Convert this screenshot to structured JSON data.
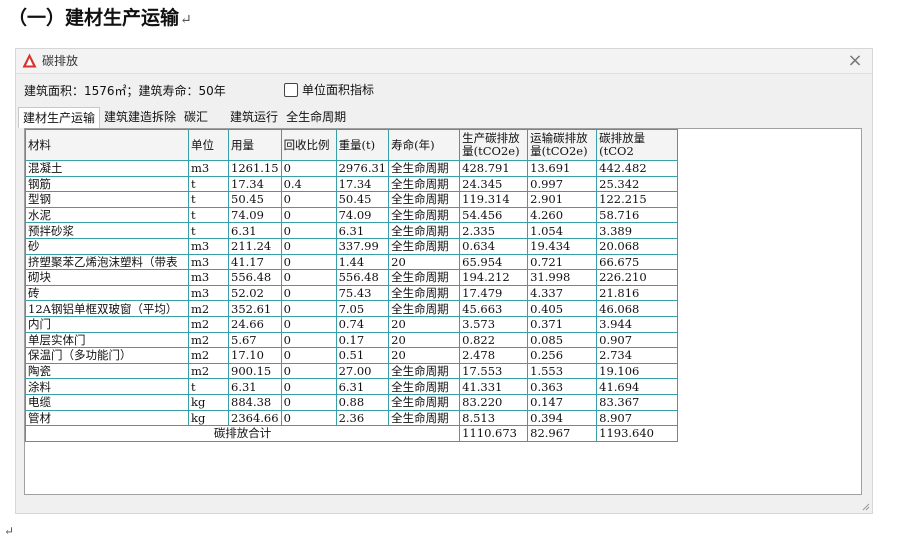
{
  "doc": {
    "heading": "（一）建材生产运输",
    "para_mark": "↵",
    "foot_mark": "↵"
  },
  "window": {
    "title": "碳排放",
    "close_glyph": "×",
    "info": "建筑面积：1576㎡；建筑寿命：50年",
    "checkbox_label": "单位面积指标",
    "tabs": [
      {
        "label": "建材生产运输",
        "active": true
      },
      {
        "label": "建筑建造拆除",
        "active": false
      },
      {
        "label": "碳汇",
        "active": false
      },
      {
        "label": "建筑运行",
        "active": false
      },
      {
        "label": "全生命周期",
        "active": false
      }
    ]
  },
  "table": {
    "columns": [
      "材料",
      "单位",
      "用量",
      "回收比例",
      "重量(t)",
      "寿命(年)",
      "生产碳排放量(tCO2e)",
      "运输碳排放量(tCO2e)",
      "碳排放量(tCO2"
    ],
    "rows": [
      [
        "混凝土",
        "m3",
        "1261.15",
        "0",
        "2976.31",
        "全生命周期",
        "428.791",
        "13.691",
        "442.482"
      ],
      [
        "钢筋",
        "t",
        "17.34",
        "0.4",
        "17.34",
        "全生命周期",
        "24.345",
        "0.997",
        "25.342"
      ],
      [
        "型钢",
        "t",
        "50.45",
        "0",
        "50.45",
        "全生命周期",
        "119.314",
        "2.901",
        "122.215"
      ],
      [
        "水泥",
        "t",
        "74.09",
        "0",
        "74.09",
        "全生命周期",
        "54.456",
        "4.260",
        "58.716"
      ],
      [
        "预拌砂浆",
        "t",
        "6.31",
        "0",
        "6.31",
        "全生命周期",
        "2.335",
        "1.054",
        "3.389"
      ],
      [
        "砂",
        "m3",
        "211.24",
        "0",
        "337.99",
        "全生命周期",
        "0.634",
        "19.434",
        "20.068"
      ],
      [
        "挤塑聚苯乙烯泡沫塑料（带表",
        "m3",
        "41.17",
        "0",
        "1.44",
        "20",
        "65.954",
        "0.721",
        "66.675"
      ],
      [
        "砌块",
        "m3",
        "556.48",
        "0",
        "556.48",
        "全生命周期",
        "194.212",
        "31.998",
        "226.210"
      ],
      [
        "砖",
        "m3",
        "52.02",
        "0",
        "75.43",
        "全生命周期",
        "17.479",
        "4.337",
        "21.816"
      ],
      [
        "12A钢铝单框双玻窗（平均）",
        "m2",
        "352.61",
        "0",
        "7.05",
        "全生命周期",
        "45.663",
        "0.405",
        "46.068"
      ],
      [
        "内门",
        "m2",
        "24.66",
        "0",
        "0.74",
        "20",
        "3.573",
        "0.371",
        "3.944"
      ],
      [
        "单层实体门",
        "m2",
        "5.67",
        "0",
        "0.17",
        "20",
        "0.822",
        "0.085",
        "0.907"
      ],
      [
        "保温门（多功能门）",
        "m2",
        "17.10",
        "0",
        "0.51",
        "20",
        "2.478",
        "0.256",
        "2.734"
      ],
      [
        "陶瓷",
        "m2",
        "900.15",
        "0",
        "27.00",
        "全生命周期",
        "17.553",
        "1.553",
        "19.106"
      ],
      [
        "涂料",
        "t",
        "6.31",
        "0",
        "6.31",
        "全生命周期",
        "41.331",
        "0.363",
        "41.694"
      ],
      [
        "电缆",
        "kg",
        "884.38",
        "0",
        "0.88",
        "全生命周期",
        "83.220",
        "0.147",
        "83.367"
      ],
      [
        "管材",
        "kg",
        "2364.66",
        "0",
        "2.36",
        "全生命周期",
        "8.513",
        "0.394",
        "8.907"
      ]
    ],
    "total": {
      "label": "碳排放合计",
      "production": "1110.673",
      "transport": "82.967",
      "sum": "1193.640"
    }
  },
  "colors": {
    "grid_line": "#39a0a8",
    "app_icon": "#d8312b"
  }
}
